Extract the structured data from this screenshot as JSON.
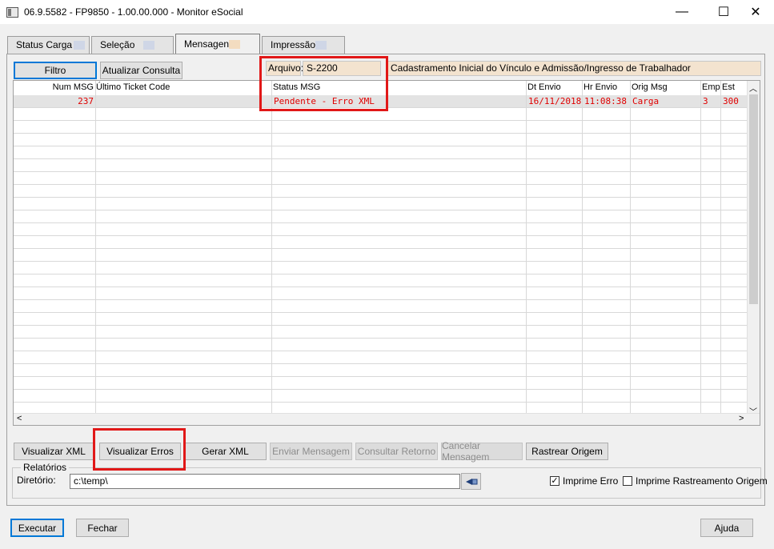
{
  "window": {
    "title": "06.9.5582 - FP9850 - 1.00.00.000 - Monitor eSocial",
    "minimize": "—",
    "maximize": "☐",
    "close": "✕"
  },
  "tabs": [
    {
      "label": "Status Carga"
    },
    {
      "label": "Seleção"
    },
    {
      "label": "Mensagens"
    },
    {
      "label": "Impressão"
    }
  ],
  "toolbar": {
    "filtro": "Filtro",
    "atualizar": "Atualizar Consulta",
    "arquivo_label": "Arquivo:",
    "arquivo_value": "S-2200",
    "arquivo_desc": "Cadastramento Inicial do Vínculo e Admissão/Ingresso de Trabalhador"
  },
  "grid": {
    "columns": [
      "Num MSG",
      "Último Ticket Code",
      "Status MSG",
      "Dt Envio",
      "Hr Envio",
      "Orig Msg",
      "Emp",
      "Est"
    ],
    "rows": [
      {
        "num": "237",
        "ticket": "",
        "status": "Pendente  - Erro XML",
        "dt": "16/11/2018",
        "hr": "11:08:38",
        "orig": "Carga",
        "emp": "3",
        "est": "300"
      }
    ]
  },
  "scroll": {
    "up": "︿",
    "down": "﹀",
    "left": "<",
    "right": ">"
  },
  "actions": {
    "visualizar_xml": "Visualizar XML",
    "visualizar_erros": "Visualizar Erros",
    "gerar_xml": "Gerar XML",
    "enviar": "Enviar Mensagem",
    "consultar": "Consultar Retorno",
    "cancelar": "Cancelar Mensagem",
    "rastrear": "Rastrear Origem"
  },
  "relatorios": {
    "legend": "Relatórios",
    "diretorio_label": "Diretório:",
    "diretorio_value": "c:\\temp\\",
    "imprime_erro": "Imprime Erro",
    "imprime_erro_checked": true,
    "imprime_rastreamento": "Imprime Rastreamento Origem",
    "imprime_rastreamento_checked": false
  },
  "footer": {
    "executar": "Executar",
    "fechar": "Fechar",
    "ajuda": "Ajuda"
  },
  "colors": {
    "highlight": "#e11818",
    "error_text": "#e00000",
    "field_bg": "#f3e3cf",
    "focus": "#0078d7"
  }
}
